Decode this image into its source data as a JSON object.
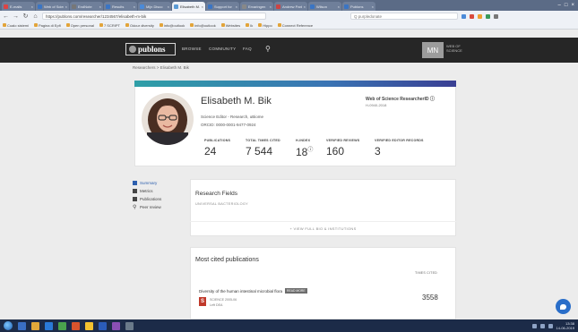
{
  "browser": {
    "tabs": [
      {
        "title": "E-mails"
      },
      {
        "title": "Web of Science"
      },
      {
        "title": "EndNote"
      },
      {
        "title": "Results"
      },
      {
        "title": "Mijn Disco"
      },
      {
        "title": "Elisabeth M."
      },
      {
        "title": "Support for"
      },
      {
        "title": "Ervaringen"
      },
      {
        "title": "Andrew Parker"
      },
      {
        "title": "Wilson"
      },
      {
        "title": "Publons"
      }
    ],
    "active_tab_index": 5,
    "url": "https://publons.com/researcher/1234567/elisabeth-m-bik",
    "address_search_placeholder": "Q  purpledonate",
    "bookmarks": [
      "Coalo sistemi",
      "Pagina di Epfl",
      "Open personal",
      "7 SCRIPT",
      "Odour diversity",
      "info@outlook",
      "info@outlook",
      "Websites",
      "Ik",
      "Hippo",
      "Connect Reference"
    ]
  },
  "publons": {
    "logo": "publons",
    "nav": [
      "BROWSE",
      "COMMUNITY",
      "FAQ"
    ],
    "user_initials": "MN",
    "wos_label_1": "WEB OF",
    "wos_label_2": "SCIENCE",
    "breadcrumb": "Researchers  >  Elisabeth M. Bik"
  },
  "profile": {
    "name": "Elisabeth M. Bik",
    "role": "Science Editor - Research, uBiome",
    "orcid": "ORCID: 0000-0001-9477-0924",
    "badge_title": "Web of Science ResearcherID ⓘ",
    "badge_id": "H-0940-2018",
    "metrics": [
      {
        "label": "PUBLICATIONS",
        "value": "24"
      },
      {
        "label": "TOTAL TIMES CITED",
        "value": "7 544"
      },
      {
        "label": "H-INDEX",
        "value": "18",
        "sup": "ⓘ"
      },
      {
        "label": "VERIFIED REVIEWS",
        "value": "160"
      },
      {
        "label": "VERIFIED EDITOR RECORDS",
        "value": "3"
      }
    ]
  },
  "sidenav": {
    "items": [
      {
        "label": "Summary"
      },
      {
        "label": "Metrics"
      },
      {
        "label": "Publications"
      },
      {
        "label": "Peer review"
      }
    ]
  },
  "research": {
    "title": "Research Fields",
    "subtitle": "UNIVERSAL BACTERIOLOGY",
    "view_full": "+ VIEW FULL BIO & INSTITUTIONS"
  },
  "cited": {
    "title": "Most cited publications",
    "times_cited_header": "TIMES CITED",
    "publication_title": "Diversity of the human intestinal microbial flora",
    "publication_badge": "READ MORE",
    "journal": "SCIENCE",
    "date": "2005-06",
    "doi": "Left DEA",
    "cites": "3558"
  },
  "taskbar": {
    "time": "13:38",
    "date": "14-06-2019"
  }
}
